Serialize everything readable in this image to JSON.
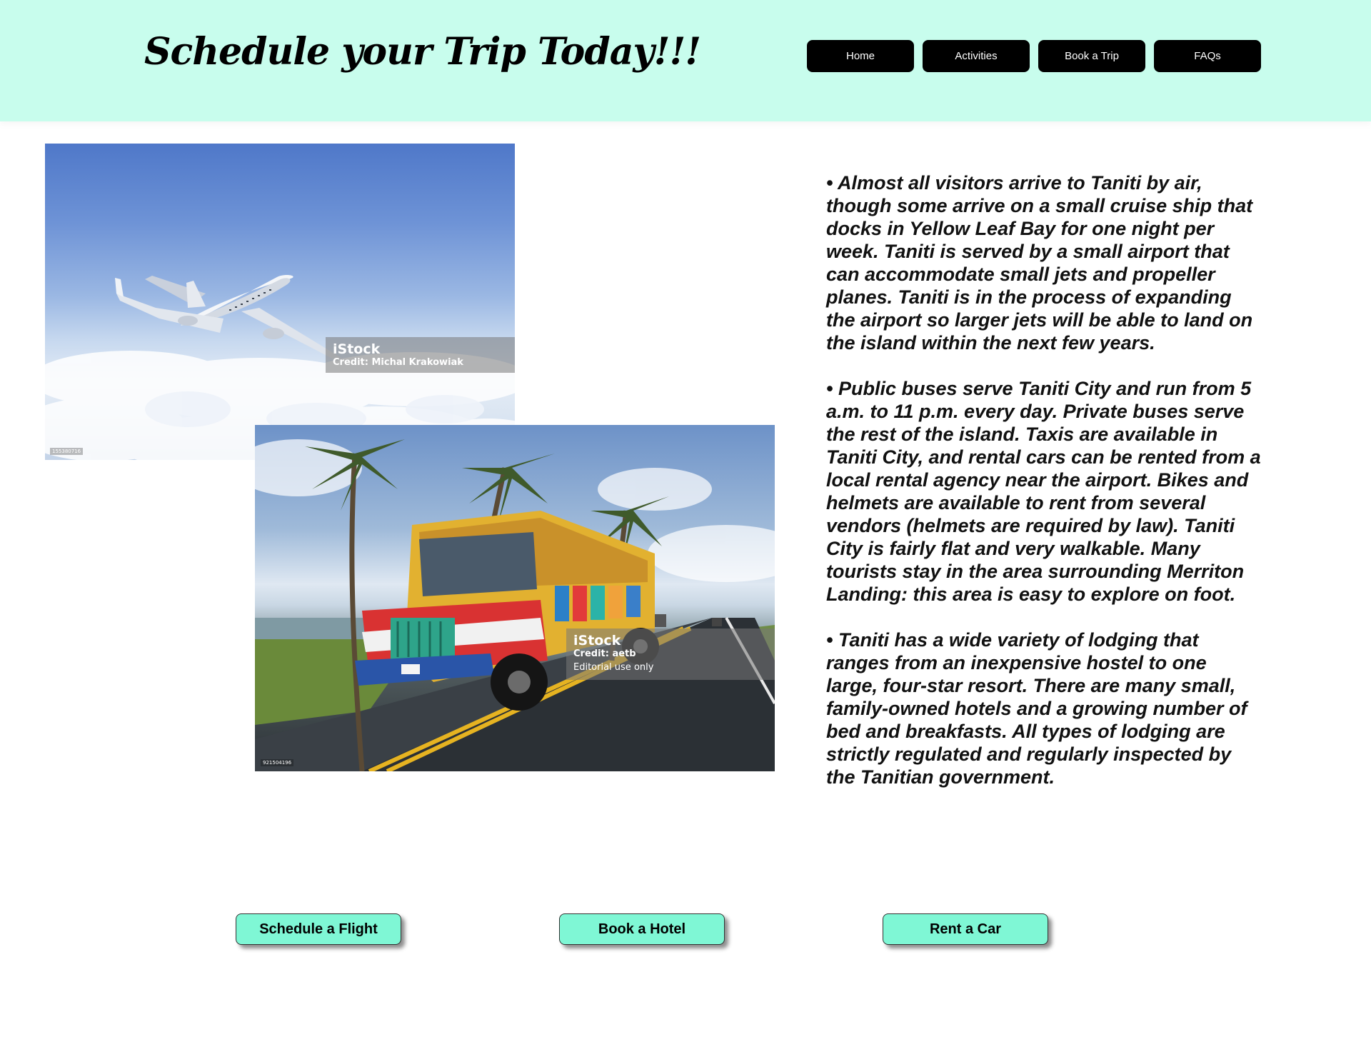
{
  "header": {
    "title": "Schedule your Trip Today!!!",
    "nav": [
      {
        "label": "Home"
      },
      {
        "label": "Activities"
      },
      {
        "label": "Book a Trip"
      },
      {
        "label": "FAQs"
      }
    ]
  },
  "images": {
    "plane": {
      "subject": "airplane-in-sky",
      "watermark_logo": "iStock",
      "watermark_credit": "Credit: Michal Krakowiak",
      "image_id": "155380716"
    },
    "bus": {
      "subject": "colorful-bus-on-coastal-road",
      "watermark_logo": "iStock",
      "watermark_credit": "Credit: aetb",
      "watermark_note": "Editorial use only",
      "image_id": "921504196"
    }
  },
  "info": {
    "paragraphs": [
      "• Almost all visitors arrive to Taniti by air, though some arrive on a small cruise ship that docks in Yellow Leaf Bay for one night per week. Taniti is served by a small airport that can accommodate small jets and propeller planes. Taniti is in the process of expanding the airport so larger jets will be able to land on the island within the next few years.",
      "• Public buses serve Taniti City and run from 5 a.m. to 11 p.m. every day. Private buses serve the rest of the island. Taxis are available in Taniti City, and rental cars can be rented from a local rental agency near the airport. Bikes and helmets are available to rent from several vendors (helmets are required by law). Taniti City is fairly flat and very walkable. Many tourists stay in the area surrounding Merriton Landing: this area is easy to explore on foot.",
      "• Taniti has a wide variety of lodging that ranges from an inexpensive hostel to one large, four-star resort. There are many small, family-owned hotels and a growing number of bed and breakfasts. All types of lodging are strictly regulated and regularly inspected by the Tanitian government."
    ]
  },
  "actions": {
    "flight": "Schedule a Flight",
    "hotel": "Book a Hotel",
    "car": "Rent a Car"
  },
  "colors": {
    "header_bg": "#c8fded",
    "nav_bg": "#000000",
    "cta_bg": "#7ff7d5"
  }
}
